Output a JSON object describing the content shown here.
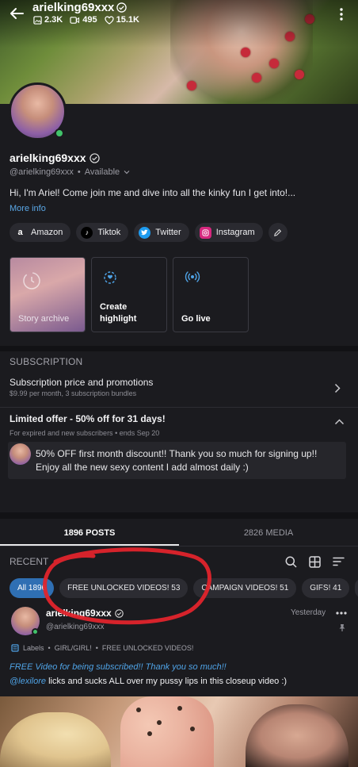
{
  "header": {
    "username": "arielking69xxx",
    "stats": {
      "photos": "2.3K",
      "videos": "495",
      "likes": "15.1K"
    }
  },
  "profile": {
    "display_name": "arielking69xxx",
    "handle": "@arielking69xxx",
    "availability": "Available",
    "bio": "Hi, I'm Ariel! Come join me and dive into all the kinky fun I get into!...",
    "more_info": "More info",
    "socials": [
      {
        "label": "Amazon",
        "icon": "amazon-icon"
      },
      {
        "label": "Tiktok",
        "icon": "tiktok-icon"
      },
      {
        "label": "Twitter",
        "icon": "twitter-icon"
      },
      {
        "label": "Instagram",
        "icon": "instagram-icon"
      }
    ],
    "tiles": {
      "story_archive": "Story archive",
      "create_highlight_1": "Create",
      "create_highlight_2": "highlight",
      "go_live": "Go live"
    }
  },
  "subscription": {
    "heading": "SUBSCRIPTION",
    "title": "Subscription price and promotions",
    "subtitle": "$9.99 per month, 3 subscription bundles"
  },
  "offer": {
    "title": "Limited offer - 50% off for 31 days!",
    "meta_audience": "For expired and new subscribers",
    "meta_ends": "ends Sep 20",
    "message_line1": "50% OFF first month discount!! Thank you so much for signing up!!",
    "message_line2": "Enjoy all the new sexy content I add almost daily :)"
  },
  "tabs": [
    {
      "label": "1896 POSTS",
      "active": true
    },
    {
      "label": "2826 MEDIA",
      "active": false
    }
  ],
  "recent_label": "RECENT",
  "filters": [
    {
      "label": "All 1896",
      "active": true
    },
    {
      "label": "FREE UNLOCKED VIDEOS! 53",
      "active": false
    },
    {
      "label": "CAMPAIGN VIDEOS! 51",
      "active": false
    },
    {
      "label": "GIFS! 41",
      "active": false
    }
  ],
  "post": {
    "name": "arielking69xxx",
    "handle": "@arielking69xxx",
    "time": "Yesterday",
    "labels_prefix": "Labels",
    "labels": [
      "GIRL/GIRL!",
      "FREE UNLOCKED VIDEOS!"
    ],
    "text_line1": "FREE Video for being subscribed!! Thank you so much!!",
    "mention": "@lexilore",
    "text_line2": " licks and sucks ALL over my pussy lips in this closeup video :)"
  },
  "colors": {
    "accent_blue": "#2f6fb3",
    "link_blue": "#4fa3e6",
    "online_green": "#41c36a",
    "annotation_red": "#e0242c",
    "background": "#1b1b1f"
  }
}
